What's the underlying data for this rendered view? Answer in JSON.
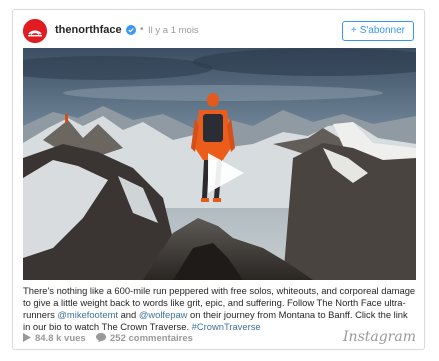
{
  "post": {
    "username": "thenorthface",
    "separator": "•",
    "time": "Il y a 1 mois",
    "follow_label": "S'abonner",
    "follow_plus": "+",
    "caption_parts": [
      "There's nothing like a 600-mile run peppered with free solos, whiteouts, and corporeal damage to give a little weight back to words like grit, epic, and suffering. Follow The North Face ultra-runners ",
      "@mikefootemt",
      " and ",
      "@wolfepaw",
      " on their journey from Montana to Banff. Click the link in our bio to watch The Crown Traverse. ",
      "#CrownTraverse"
    ]
  },
  "footer": {
    "views": "84.8 k vues",
    "comments": "252 commentaires",
    "brand": "Instagram"
  },
  "colors": {
    "accent": "#3897f0",
    "link": "#3f729b",
    "avatar": "#e11b22",
    "muted": "#999999"
  },
  "icons": {
    "verified": "verified-badge-icon",
    "play": "play-icon",
    "views": "play-small-icon",
    "comments": "comment-bubble-icon"
  }
}
